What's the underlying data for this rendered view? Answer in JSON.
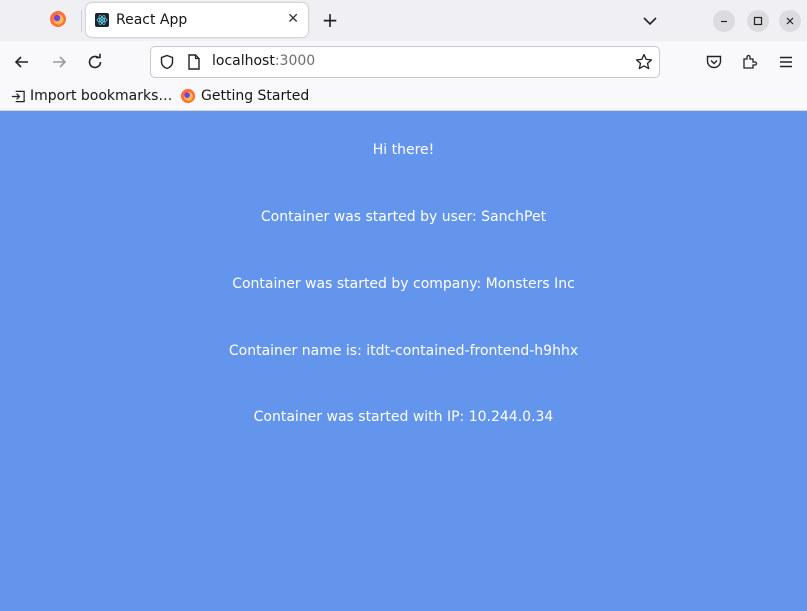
{
  "browser": {
    "tab": {
      "title": "React App",
      "favicon": "react-icon"
    },
    "url": {
      "host": "localhost",
      "port": ":3000"
    },
    "bookmarks": [
      {
        "label": "Import bookmarks…",
        "icon": "import-icon"
      },
      {
        "label": "Getting Started",
        "icon": "firefox-icon"
      }
    ]
  },
  "page": {
    "background": "#6495ED",
    "lines": [
      "Hi there!",
      "Container was started by user: SanchPet",
      "Container was started by company: Monsters Inc",
      "Container name is: itdt-contained-frontend-h9hhx",
      "Container was started with IP: 10.244.0.34"
    ]
  }
}
